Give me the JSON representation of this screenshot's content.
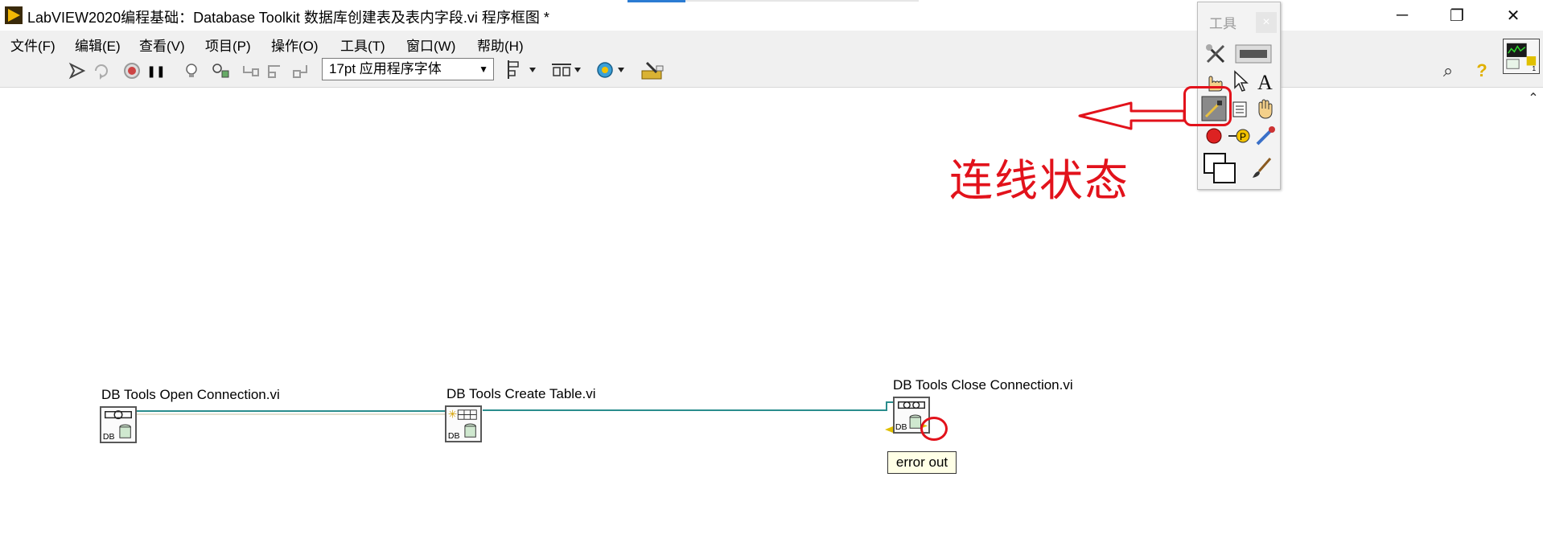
{
  "window": {
    "title": "LabVIEW2020编程基础：Database Toolkit 数据库创建表及表内字段.vi 程序框图 *",
    "controls": {
      "minimize": "─",
      "restore": "❐",
      "close": "✕"
    }
  },
  "menu": {
    "items": [
      "文件(F)",
      "编辑(E)",
      "查看(V)",
      "项目(P)",
      "操作(O)",
      "工具(T)",
      "窗口(W)",
      "帮助(H)"
    ]
  },
  "toolbar": {
    "font_select": {
      "value": "17pt 应用程序字体",
      "arrow": "▼"
    },
    "icons": [
      "run-arrow-icon",
      "run-continuously-icon",
      "abort-icon",
      "pause-icon",
      "highlight-execution-icon",
      "retain-wire-values-icon",
      "step-into-icon",
      "step-over-icon",
      "step-out-icon",
      "align-icon",
      "distribute-icon",
      "reorder-icon",
      "cleanup-icon",
      "search-icon",
      "help-icon"
    ],
    "pause_glyph": "❚❚",
    "help_glyph": "?",
    "search_glyph": "⌕"
  },
  "palette": {
    "title": "工具",
    "close": "×",
    "tools": [
      "automatic-tool-selection-icon",
      "operate-value-icon",
      "position-select-icon",
      "edit-text-icon",
      "connect-wire-icon",
      "object-shortcut-menu-icon",
      "scroll-window-icon",
      "breakpoint-icon",
      "probe-icon",
      "get-color-icon",
      "set-color-icon",
      "brush-icon"
    ]
  },
  "annotation": {
    "text": "连线状态",
    "color": "#e2121b"
  },
  "diagram": {
    "wire_color": "#2a8d8d",
    "nodes": [
      {
        "label": "DB Tools Open Connection.vi",
        "icon_tag": "DB"
      },
      {
        "label": "DB Tools Create Table.vi",
        "icon_tag": "DB"
      },
      {
        "label": "DB Tools Close Connection.vi",
        "icon_tag": "DB"
      }
    ],
    "tooltip": "error out"
  },
  "scroll": {
    "up": "⌃"
  }
}
